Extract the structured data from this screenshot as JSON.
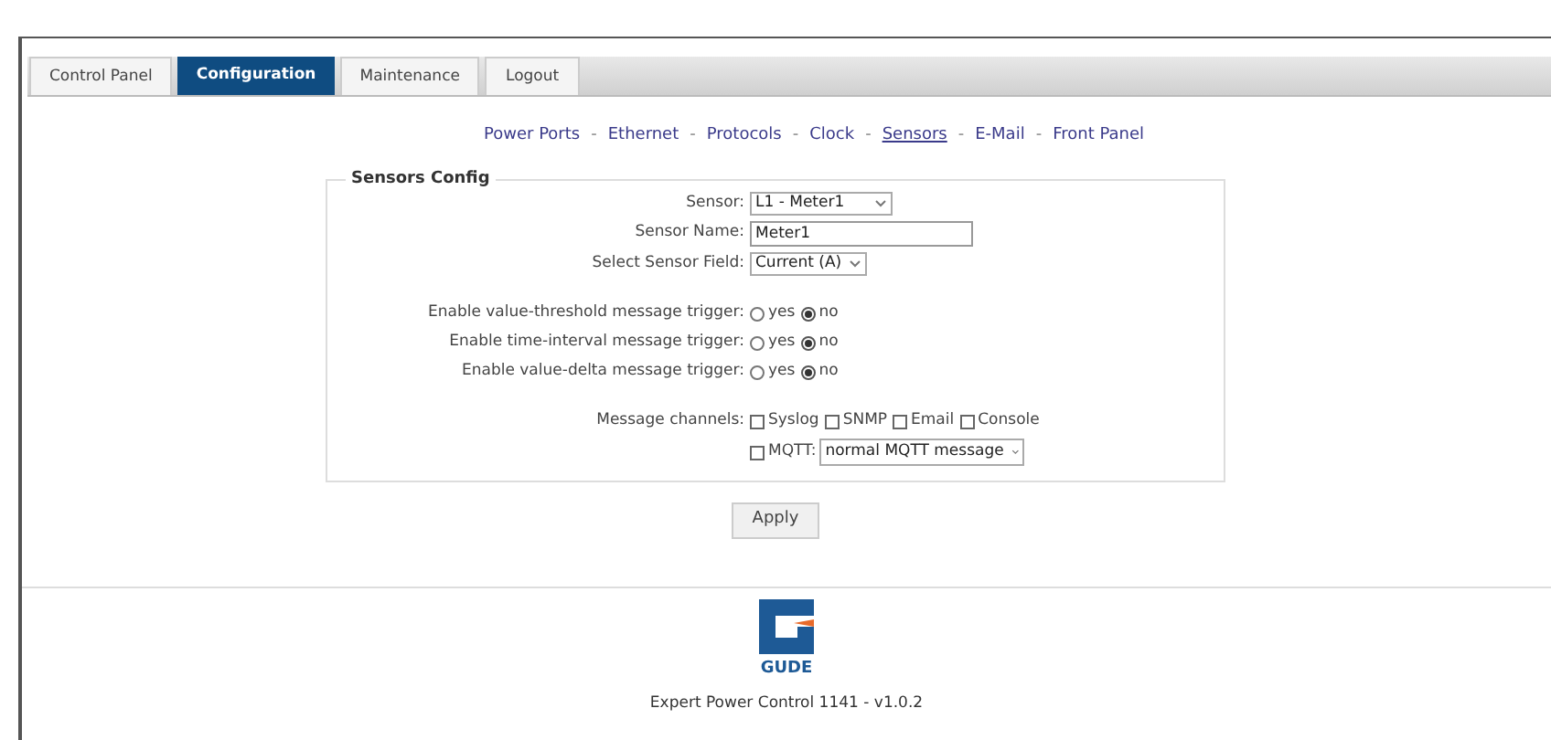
{
  "tabs": [
    {
      "label": "Control Panel",
      "selected": false
    },
    {
      "label": "Configuration",
      "selected": true
    },
    {
      "label": "Maintenance",
      "selected": false
    },
    {
      "label": "Logout",
      "selected": false
    }
  ],
  "nav_links": [
    {
      "label": "Power Ports",
      "selected": false
    },
    {
      "label": "Ethernet",
      "selected": false
    },
    {
      "label": "Protocols",
      "selected": false
    },
    {
      "label": "Clock",
      "selected": false
    },
    {
      "label": "Sensors",
      "selected": true
    },
    {
      "label": "E-Mail",
      "selected": false
    },
    {
      "label": "Front Panel",
      "selected": false
    }
  ],
  "nav_separator": "-",
  "legend": "Sensors Config",
  "rows": [
    {
      "kind": "select",
      "label": "Sensor:",
      "value": "L1 - Meter1"
    },
    {
      "kind": "input",
      "label": "Sensor Name:",
      "value": "Meter1"
    },
    {
      "kind": "select",
      "label": "Select Sensor Field:",
      "value": "Current (A)"
    },
    {
      "kind": "spacer"
    },
    {
      "kind": "radio",
      "label": "Enable value-threshold message trigger:",
      "options": [
        {
          "label": "yes",
          "selected": false
        },
        {
          "label": "no",
          "selected": true
        }
      ]
    },
    {
      "kind": "radio",
      "label": "Enable time-interval message trigger:",
      "options": [
        {
          "label": "yes",
          "selected": false
        },
        {
          "label": "no",
          "selected": true
        }
      ]
    },
    {
      "kind": "radio",
      "label": "Enable value-delta message trigger:",
      "options": [
        {
          "label": "yes",
          "selected": false
        },
        {
          "label": "no",
          "selected": true
        }
      ]
    },
    {
      "kind": "spacer"
    },
    {
      "kind": "channels",
      "label": "Message channels:",
      "checkboxes": [
        {
          "label": "Syslog",
          "checked": false
        },
        {
          "label": "SNMP",
          "checked": false
        },
        {
          "label": "Email",
          "checked": false
        },
        {
          "label": "Console",
          "checked": false
        }
      ],
      "mqtt": {
        "label": "MQTT:",
        "checked": false,
        "value": "normal MQTT message"
      }
    }
  ],
  "apply_button": "Apply",
  "logo_text": "GUDE",
  "footer": "Expert Power Control 1141 - v1.0.2"
}
